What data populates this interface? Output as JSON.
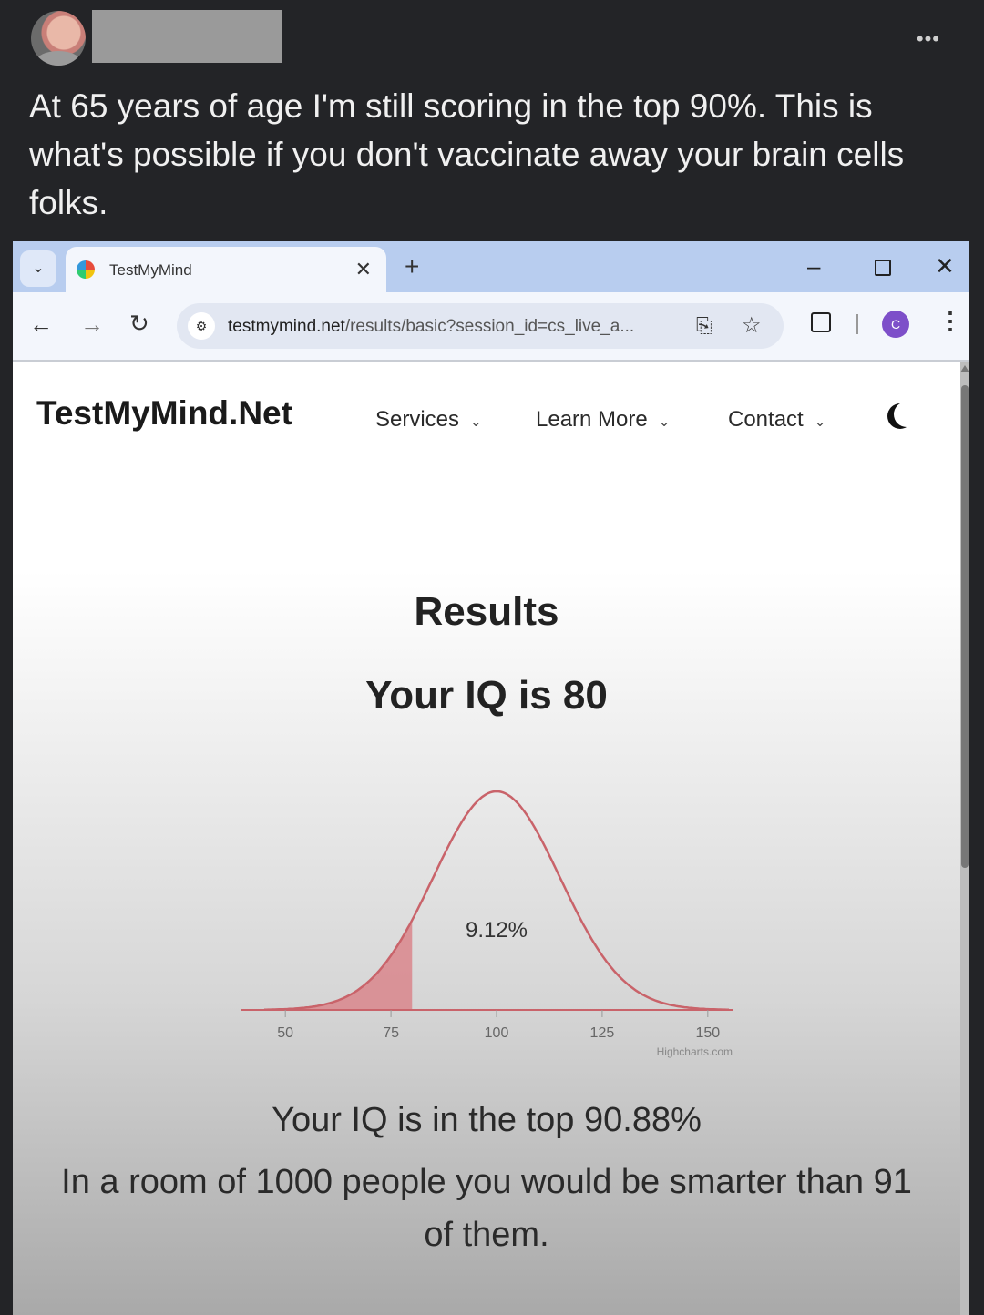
{
  "post": {
    "text": "At 65 years of age I'm still scoring in the top 90%. This is what's possible if you don't vaccinate away your brain cells folks.",
    "more_icon": "more-dots-icon"
  },
  "browser": {
    "tab_title": "TestMyMind",
    "url_domain": "testmymind.net",
    "url_path": "/results/basic?session_id=cs_live_a...",
    "profile_initial": "C"
  },
  "site": {
    "brand": "TestMyMind.Net",
    "nav": [
      "Services",
      "Learn More",
      "Contact"
    ],
    "results_title": "Results",
    "iq_title": "Your IQ is 80",
    "top_text": "Your IQ is in the top 90.88%",
    "room_text": "In a room of 1000 people you would be smarter than 91 of them."
  },
  "chart_data": {
    "type": "area",
    "x_ticks": [
      50,
      75,
      100,
      125,
      150
    ],
    "mean": 100,
    "sd": 15,
    "shaded_to": 80,
    "annotation": "9.12%",
    "credits": "Highcharts.com",
    "line_color": "#c9636a",
    "fill_color": "#d9868c"
  }
}
